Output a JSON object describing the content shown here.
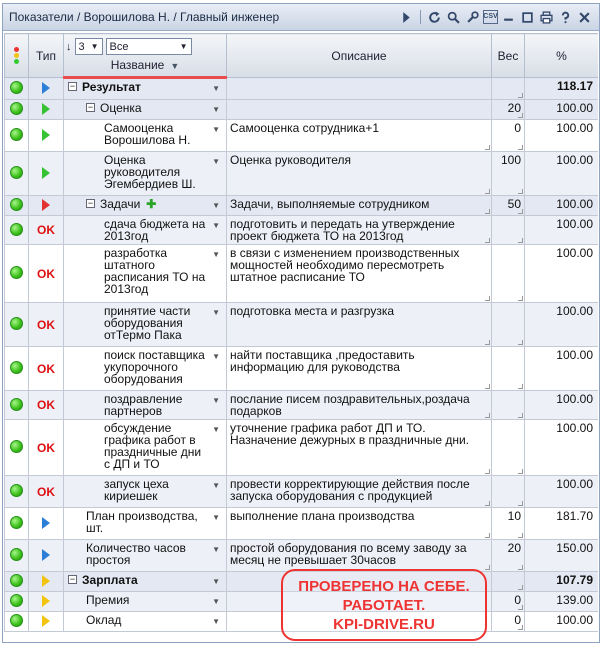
{
  "window": {
    "title": "Показатели / Ворошилова Н. / Главный инженер",
    "tools": {
      "csv_label": "CSV"
    }
  },
  "header": {
    "col_type": "Тип",
    "level_value": "3",
    "filter_value": "Все",
    "col_name": "Название",
    "col_desc": "Описание",
    "col_weight": "Вес",
    "col_pct": "%"
  },
  "rows": [
    {
      "name": "Результат",
      "desc": "",
      "weight": "",
      "pct": "118.17",
      "icon": "blue-tri",
      "bold": true
    },
    {
      "name": "Оценка",
      "desc": "",
      "weight": "20",
      "pct": "100.00",
      "icon": "green-tri"
    },
    {
      "name": "Самооценка Ворошилова Н.",
      "desc": "Самооценка сотрудника+1",
      "weight": "0",
      "pct": "100.00",
      "icon": "green-tri"
    },
    {
      "name": "Оценка руководителя Эгембердиев Ш.",
      "desc": "Оценка руководителя",
      "weight": "100",
      "pct": "100.00",
      "icon": "green-tri"
    },
    {
      "name": "Задачи",
      "desc": "Задачи, выполняемые сотрудником",
      "weight": "50",
      "pct": "100.00",
      "icon": "red-tri"
    },
    {
      "name": "сдача бюджета на 2013год",
      "desc": "подготовить и передать на утверждение проект бюджета ТО на 2013год",
      "weight": "",
      "pct": "100.00",
      "type": "OK"
    },
    {
      "name": "разработка штатного расписания ТО на 2013год",
      "desc": "в связи с изменением производственных мощностей необходимо пересмотреть штатное расписание ТО",
      "weight": "",
      "pct": "100.00",
      "type": "OK"
    },
    {
      "name": "принятие части оборудования отТермо Пака",
      "desc": "подготовка места и разгрузка",
      "weight": "",
      "pct": "100.00",
      "type": "OK"
    },
    {
      "name": "поиск поставщика укупорочного оборудования",
      "desc": "найти поставщика ,предоставить информацию для руководства",
      "weight": "",
      "pct": "100.00",
      "type": "OK"
    },
    {
      "name": "поздравление партнеров",
      "desc": "послание писем поздравительных,роздача подарков",
      "weight": "",
      "pct": "100.00",
      "type": "OK"
    },
    {
      "name": "обсуждение графика работ в праздничные дни с ДП и ТО",
      "desc": "уточнение графика работ ДП и ТО. Назначение дежурных в праздничные дни.",
      "weight": "",
      "pct": "100.00",
      "type": "OK"
    },
    {
      "name": "запуск цеха кириешек",
      "desc": "провести корректирующие действия после запуска оборудования с продукцией",
      "weight": "",
      "pct": "100.00",
      "type": "OK"
    },
    {
      "name": "План производства, шт.",
      "desc": "выполнение плана производства",
      "weight": "10",
      "pct": "181.70",
      "icon": "blue-tri"
    },
    {
      "name": "Количество часов простоя",
      "desc": "простой оборудования по всему заводу за месяц не превышает 30часов",
      "weight": "20",
      "pct": "150.00",
      "icon": "blue-tri"
    },
    {
      "name": "Зарплата",
      "desc": "",
      "weight": "",
      "pct": "107.79",
      "icon": "yellow-tri",
      "bold": true
    },
    {
      "name": "Премия",
      "desc": "",
      "weight": "0",
      "pct": "139.00",
      "icon": "yellow-tri"
    },
    {
      "name": "Оклад",
      "desc": "",
      "weight": "0",
      "pct": "100.00",
      "icon": "yellow-tri"
    }
  ],
  "stamp": {
    "line1": "ПРОВЕРЕНО НА СЕБЕ.",
    "line2": "РАБОТАЕТ.",
    "line3": "KPI-DRIVE.RU"
  },
  "colors": {
    "status_green": "#3fc31d",
    "ok_red": "#dd1111",
    "stamp_red": "#ee3333"
  }
}
